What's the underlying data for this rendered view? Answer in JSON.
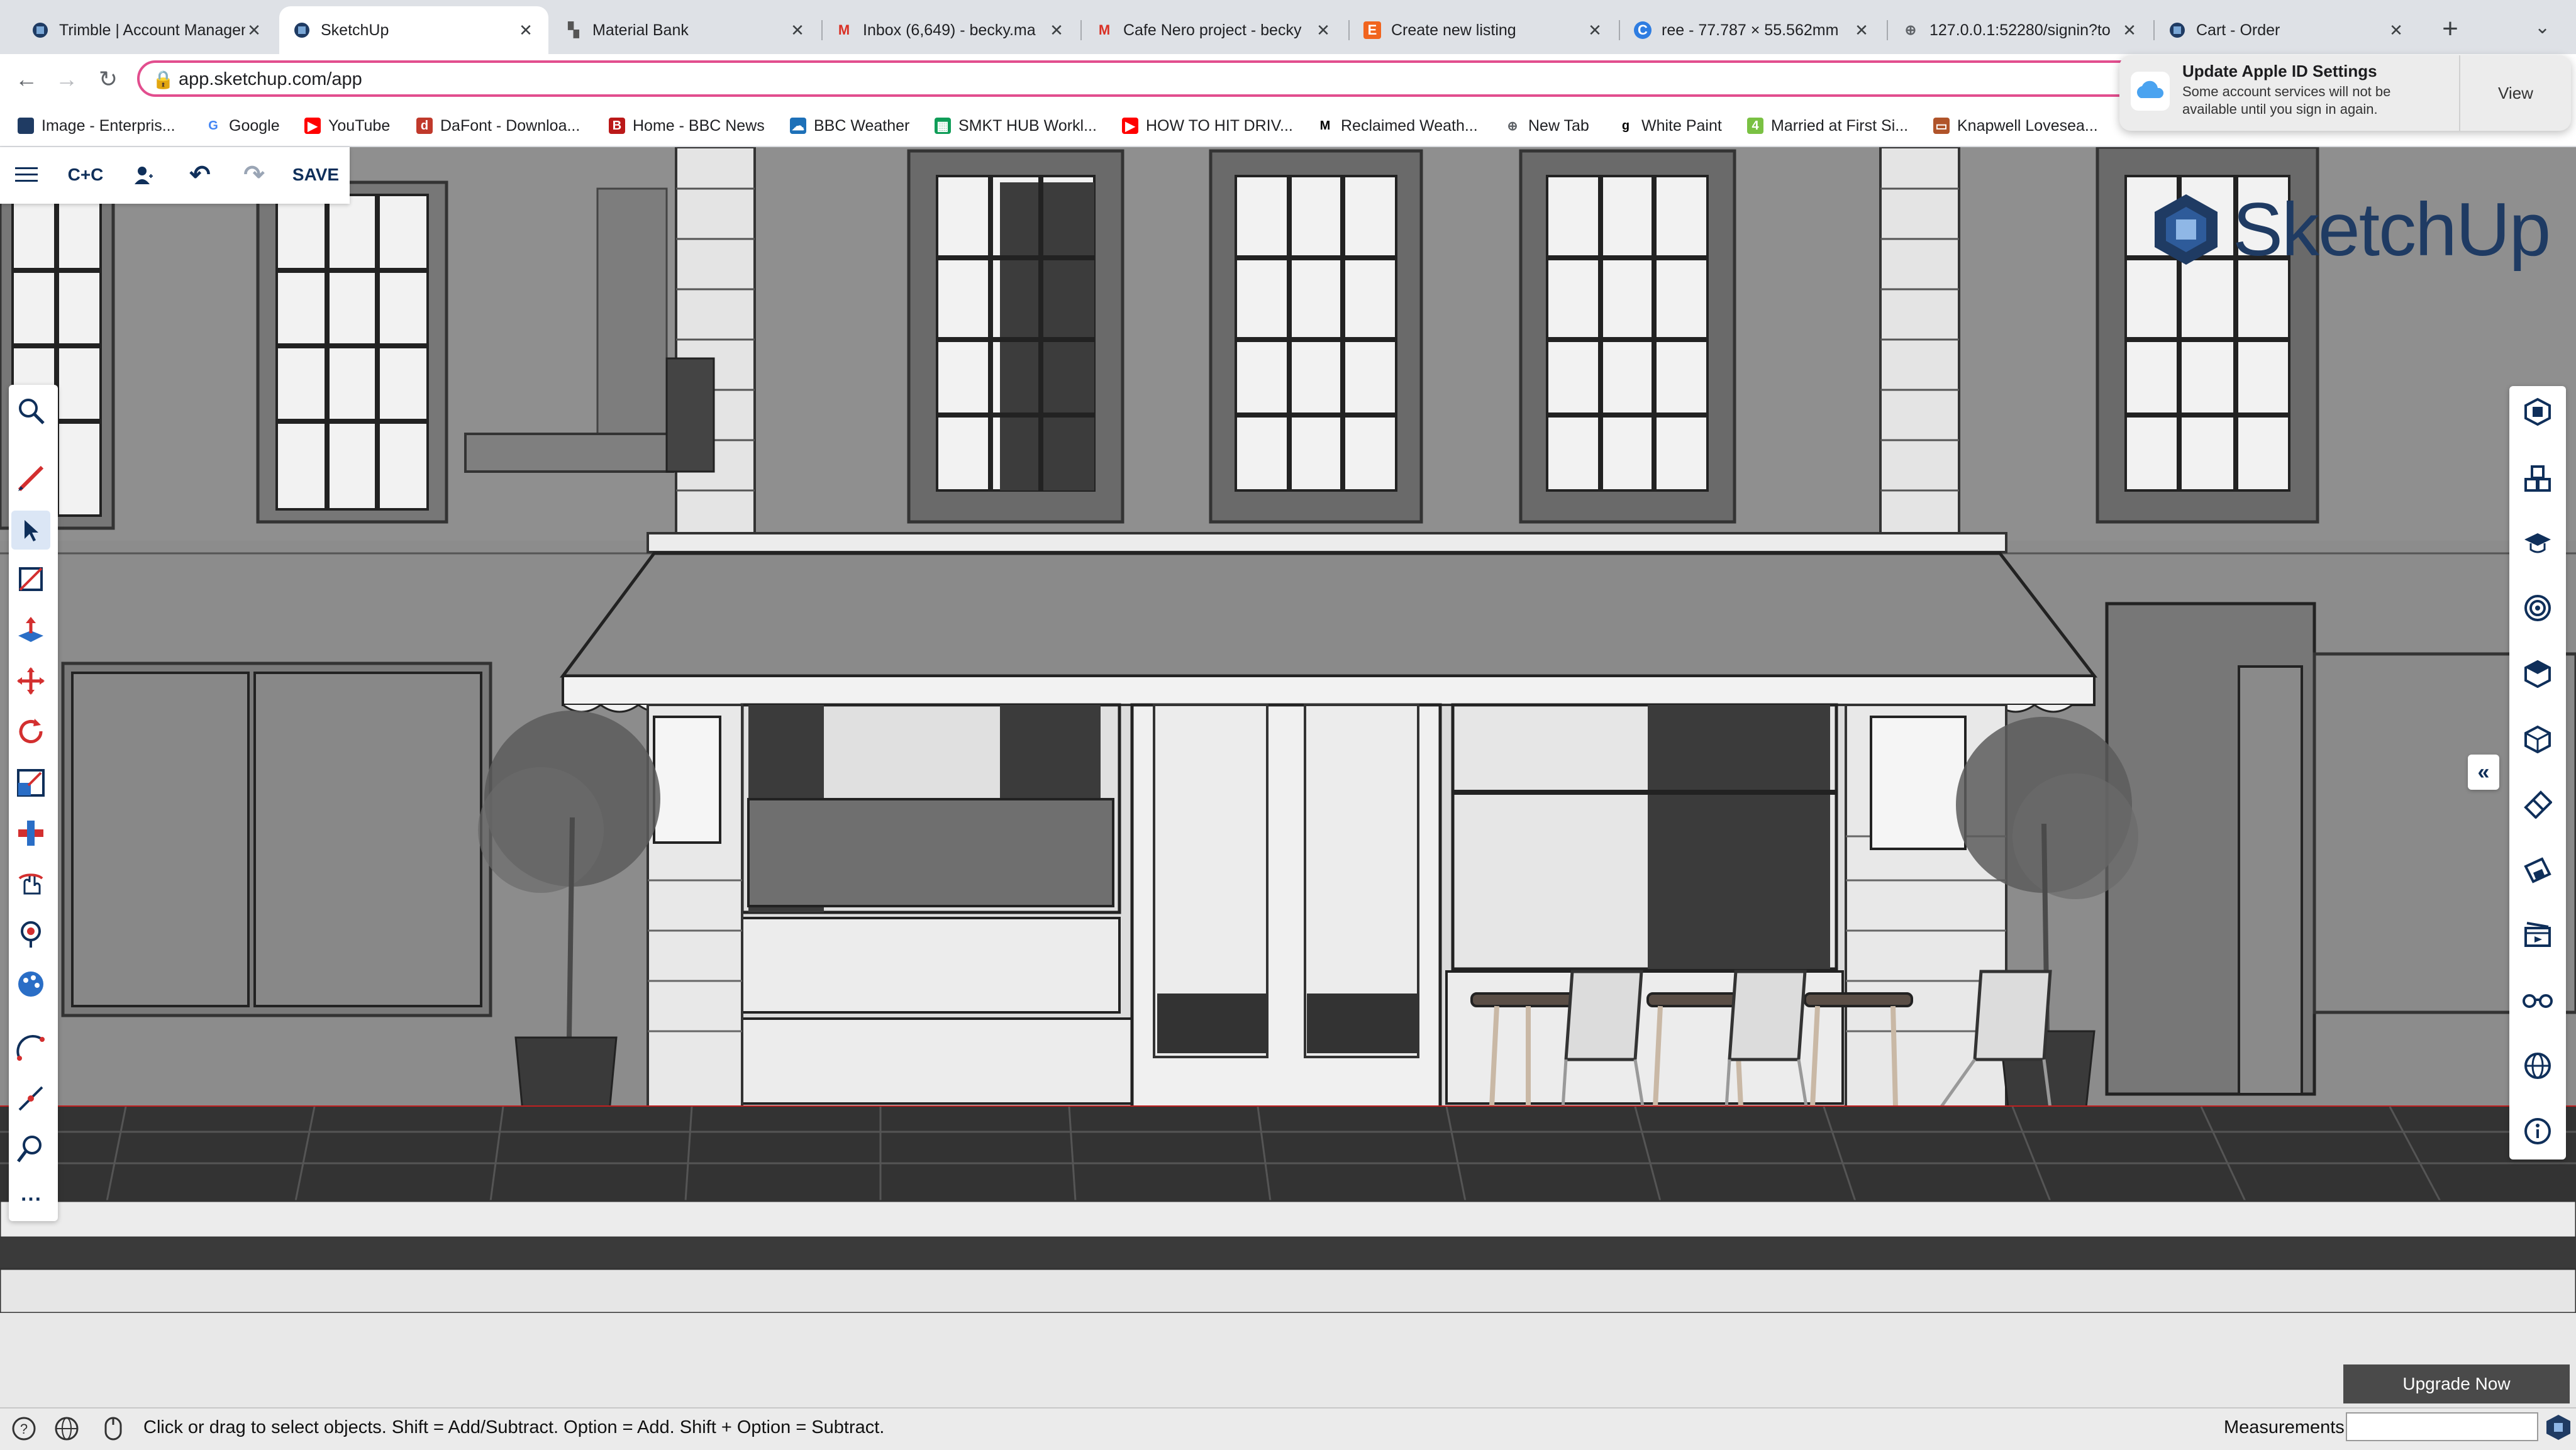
{
  "browser": {
    "tabs": [
      {
        "title": "Trimble | Account Management",
        "icon": "trimble-icon",
        "active": false
      },
      {
        "title": "SketchUp",
        "icon": "sketchup-icon",
        "active": true
      },
      {
        "title": "Material Bank",
        "icon": "material-bank-icon",
        "active": false
      },
      {
        "title": "Inbox (6,649) - becky.ma",
        "icon": "gmail-icon",
        "active": false
      },
      {
        "title": "Cafe Nero project - becky",
        "icon": "gmail-icon",
        "active": false
      },
      {
        "title": "Create new listing",
        "icon": "etsy-icon",
        "active": false
      },
      {
        "title": "ree - 77.787 × 55.562mm",
        "icon": "canva-icon",
        "active": false
      },
      {
        "title": "127.0.0.1:52280/signin?to",
        "icon": "globe-icon",
        "active": false
      },
      {
        "title": "Cart - Order",
        "icon": "trimble-icon",
        "active": false
      }
    ],
    "url": "app.sketchup.com/app",
    "bookmarks": [
      {
        "label": "Image - Enterpris...",
        "icon": "trimble-icon"
      },
      {
        "label": "Google",
        "icon": "google-icon"
      },
      {
        "label": "YouTube",
        "icon": "youtube-icon"
      },
      {
        "label": "DaFont - Downloa...",
        "icon": "dafont-icon"
      },
      {
        "label": "Home - BBC News",
        "icon": "bbc-news-icon"
      },
      {
        "label": "BBC Weather",
        "icon": "bbc-weather-icon"
      },
      {
        "label": "SMKT HUB Workl...",
        "icon": "sheets-icon"
      },
      {
        "label": "HOW TO HIT DRIV...",
        "icon": "youtube-icon"
      },
      {
        "label": "Reclaimed Weath...",
        "icon": "medium-icon"
      },
      {
        "label": "New Tab",
        "icon": "globe-icon"
      },
      {
        "label": "White Paint",
        "icon": "goodreads-icon"
      },
      {
        "label": "Married at First Si...",
        "icon": "channel4-icon"
      },
      {
        "label": "Knapwell Lovesea...",
        "icon": "furniture-icon"
      }
    ]
  },
  "notification": {
    "title": "Update Apple ID Settings",
    "body": "Some account services will not be available until you sign in again.",
    "action": "View"
  },
  "app": {
    "top_bar": {
      "menu_icon": "hamburger-icon",
      "copy_label": "C+C",
      "user_icon": "user-icon",
      "undo_icon": "undo-icon",
      "redo_icon": "redo-icon",
      "save_label": "SAVE"
    },
    "brand": "SketchUp",
    "left_tools": [
      "search-icon",
      "pencil-icon",
      "select-icon",
      "rectangle-icon",
      "push-pull-icon",
      "move-icon",
      "rotate-icon",
      "scale-icon",
      "follow-me-icon",
      "orbit-icon",
      "paint-bucket-icon",
      "paint-icon",
      "arc-icon",
      "line-icon",
      "zoom-icon",
      "more-icon"
    ],
    "right_tools": [
      "entity-info-icon",
      "components-icon",
      "instructor-icon",
      "materials-icon",
      "styles-icon",
      "scenes-icon",
      "eraser-icon",
      "tags-icon",
      "animation-icon",
      "display-icon",
      "globe-icon",
      "info-icon"
    ],
    "upgrade_label": "Upgrade Now",
    "status_text": "Click or drag to select objects. Shift = Add/Subtract. Option = Add. Shift + Option = Subtract.",
    "measurements_label": "Measurements",
    "measurements_value": ""
  },
  "colors": {
    "brand": "#1f3b63",
    "selection_blue": "#2a6ec6",
    "red_tool": "#d32f2f",
    "highlight": "#e24e8e"
  }
}
